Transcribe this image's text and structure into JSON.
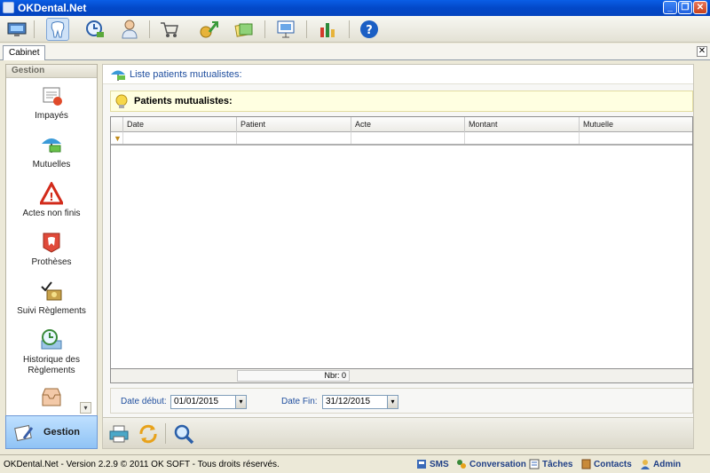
{
  "window": {
    "title": "OKDental.Net"
  },
  "tab": {
    "label": "Cabinet"
  },
  "sidebar": {
    "header": "Gestion",
    "items": [
      {
        "label": "Impayés"
      },
      {
        "label": "Mutuelles"
      },
      {
        "label": "Actes non finis"
      },
      {
        "label": "Prothèses"
      },
      {
        "label": "Suivi Règlements"
      },
      {
        "label": "Historique des Règlements"
      }
    ],
    "active_group": "Gestion"
  },
  "main": {
    "header": "Liste patients mutualistes:",
    "info": "Patients mutualistes:",
    "columns": [
      "Date",
      "Patient",
      "Acte",
      "Montant",
      "Mutuelle"
    ],
    "footer_count": "Nbr: 0",
    "date_start_label": "Date début:",
    "date_start_value": "01/01/2015",
    "date_end_label": "Date Fin:",
    "date_end_value": "31/12/2015"
  },
  "status": {
    "copyright": "OKDental.Net - Version 2.2.9 © 2011 OK SOFT - Tous droits réservés.",
    "items": [
      {
        "label": "SMS"
      },
      {
        "label": "Conversation"
      },
      {
        "label": "Tâches"
      },
      {
        "label": "Contacts"
      },
      {
        "label": "Admin"
      }
    ]
  },
  "colors": {
    "accent": "#1f4e9e",
    "titlebar": "#0348c8",
    "info_bg": "#ffffe1"
  }
}
